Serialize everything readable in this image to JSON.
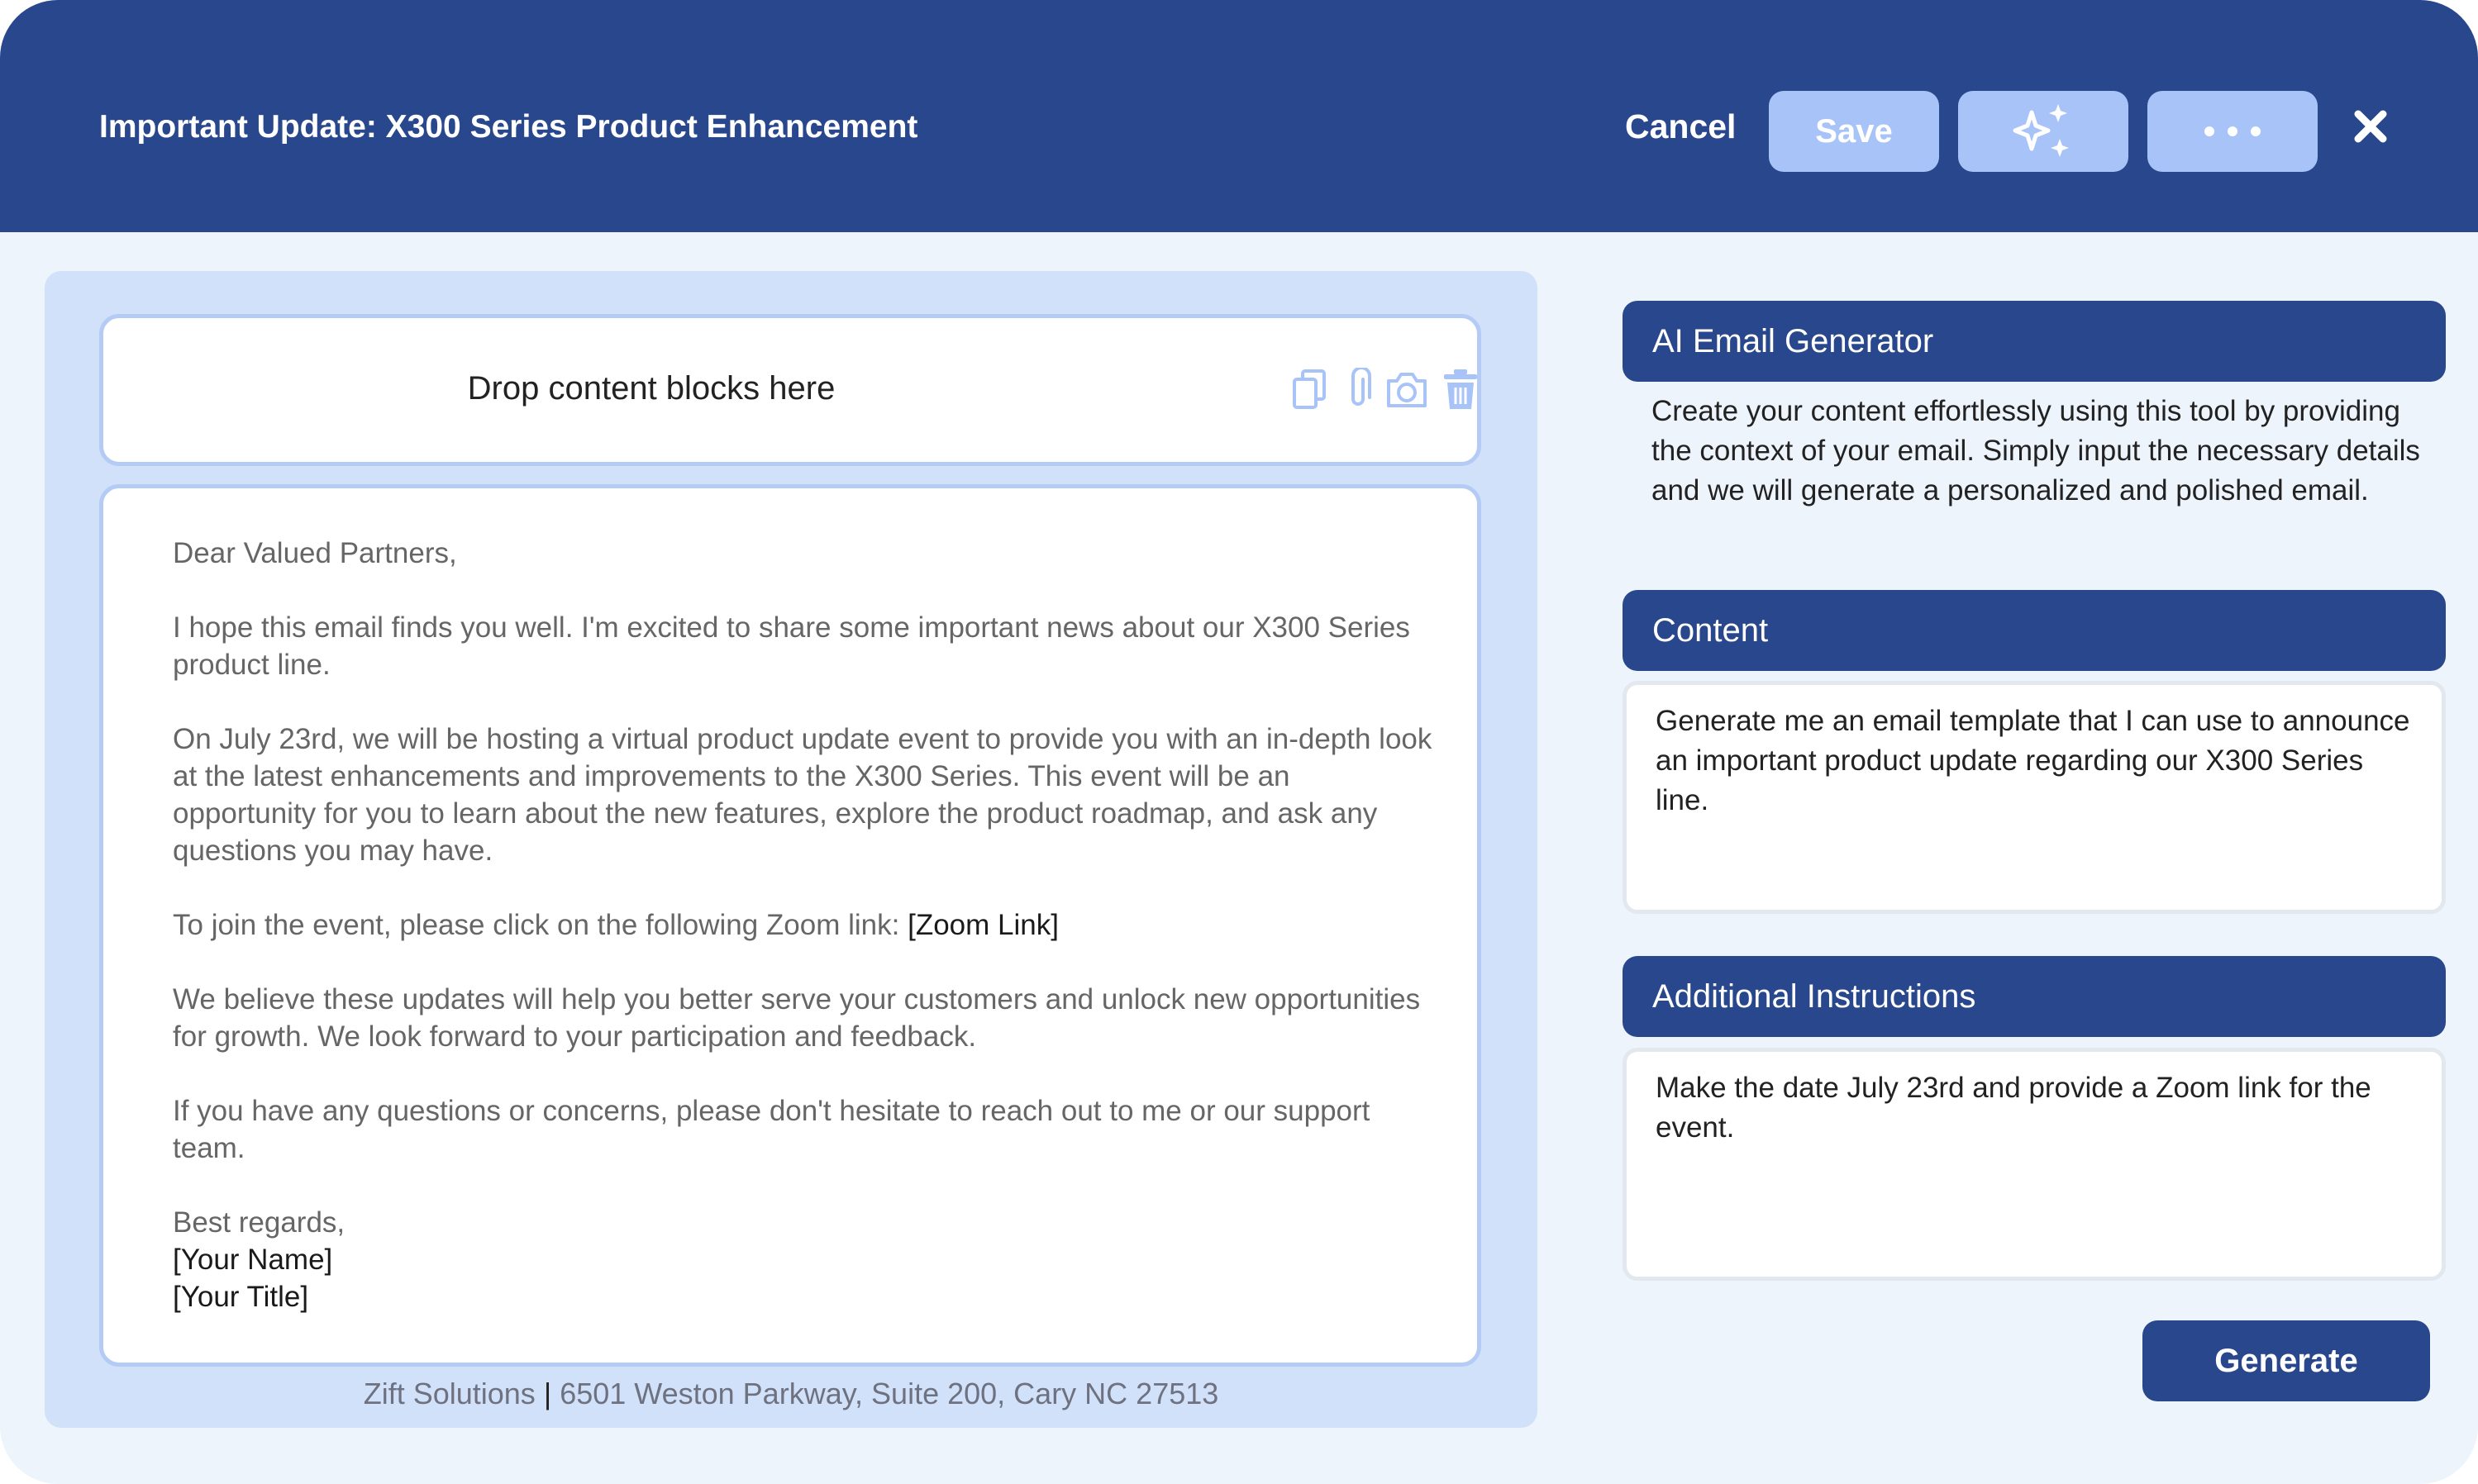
{
  "header": {
    "title": "Important Update: X300 Series Product Enhancement",
    "cancel_label": "Cancel",
    "save_label": "Save",
    "ai_button_icon": "sparkles-icon",
    "more_button_icon": "more-dots-icon",
    "close_icon": "close-icon"
  },
  "editor": {
    "dropzone_label": "Drop content blocks here",
    "dropzone_icons": [
      "copy-icon",
      "paperclip-icon",
      "camera-icon",
      "trash-icon"
    ],
    "email": {
      "greeting": "Dear Valued Partners,",
      "p1": "I hope this email finds you well. I'm excited to share some important news about our X300 Series product line.",
      "p2": "On July 23rd, we will be hosting a virtual product update event to provide you with an in-depth look at the latest enhancements and improvements to the X300 Series. This event will be an opportunity for you to learn about the new features, explore the product roadmap, and ask any questions you may have.",
      "p3_prefix": "To join the event, please click on the following Zoom link: ",
      "p3_link": "[Zoom Link]",
      "p4": "We believe these updates will help you better serve your customers and unlock new opportunities for growth. We look forward to your participation and feedback.",
      "p5": "If you have any questions or concerns, please don't hesitate to reach out to me or our support team.",
      "closing": "Best regards,",
      "name": "[Your Name]",
      "title": "[Your Title]"
    },
    "footer": {
      "company": "Zift Solutions",
      "separator": "|",
      "address": "6501 Weston Parkway, Suite 200, Cary NC 27513"
    }
  },
  "sidebar": {
    "generator_heading": "AI Email Generator",
    "generator_description": "Create your content effortlessly using this tool by providing the context of your email. Simply input the necessary details and we will generate a personalized and polished email.",
    "content_heading": "Content",
    "content_value": "Generate me an email template that I can use to announce an important product update regarding our X300 Series line.",
    "instructions_heading": "Additional Instructions",
    "instructions_value": "Make the date July 23rd and provide a Zoom link for the event.",
    "generate_label": "Generate"
  },
  "colors": {
    "primary": "#29478c",
    "accent_light": "#a7c3f7",
    "panel": "#d2e1fa",
    "background": "#eef4fc"
  }
}
